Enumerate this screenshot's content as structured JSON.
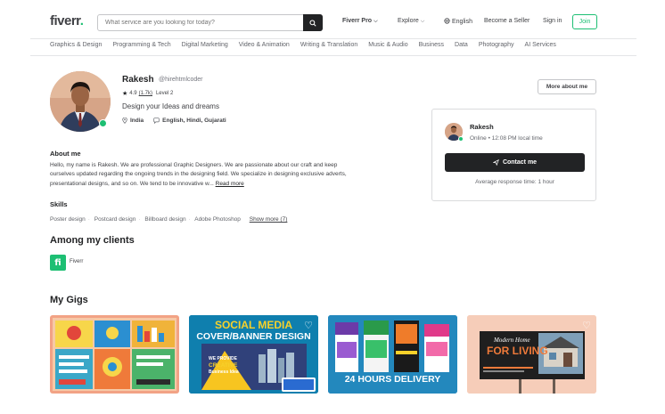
{
  "header": {
    "logo": "fiverr",
    "logo_dot": ".",
    "search_placeholder": "What service are you looking for today?",
    "nav_pro": "Fiverr Pro",
    "nav_explore": "Explore",
    "nav_language": "English",
    "nav_seller": "Become a Seller",
    "nav_signin": "Sign in",
    "join": "Join"
  },
  "categories": [
    "Graphics & Design",
    "Programming & Tech",
    "Digital Marketing",
    "Video & Animation",
    "Writing & Translation",
    "Music & Audio",
    "Business",
    "Data",
    "Photography",
    "AI Services"
  ],
  "profile": {
    "name": "Rakesh",
    "handle": "@hirehtmlcoder",
    "rating": "4.9",
    "review_count": "(1.7k)",
    "level": "Level 2",
    "tagline": "Design your Ideas and dreams",
    "location": "India",
    "languages": "English, Hindi, Gujarati",
    "more_about": "More about me"
  },
  "contact_card": {
    "name": "Rakesh",
    "status": "Online • 12:08 PM local time",
    "button": "Contact me",
    "response": "Average response time: 1 hour"
  },
  "about": {
    "heading": "About me",
    "text": "Hello, my name is Rakesh. We are professional Graphic Designers. We are passionate about our craft and keep ourselves updated regarding the ongoing trends in the designing field. We specialize in designing exclusive adverts, presentational designs, and so on. We tend to be innovative w...",
    "read_more": "Read more"
  },
  "skills": {
    "heading": "Skills",
    "items": [
      "Poster design",
      "Postcard design",
      "Billboard design",
      "Adobe Photoshop"
    ],
    "show_more": "Show more (7)"
  },
  "clients": {
    "heading": "Among my clients",
    "logo_letter": "fi",
    "name": "Fiverr"
  },
  "gigs": {
    "heading": "My Gigs",
    "gig2_title_1": "SOCIAL MEDIA",
    "gig2_title_2": "COVER/BANNER DESIGN",
    "gig2_badge_1": "WE PROVIDE",
    "gig2_badge_2": "CREATIVE",
    "gig2_badge_3": "Business Idea",
    "gig3_banner": "24 HOURS DELIVERY",
    "gig4_title_1": "Modern Home",
    "gig4_title_2": "FOR LIVING"
  },
  "icons": {
    "search": "search-icon",
    "globe": "globe-icon",
    "location": "location-pin-icon",
    "chat": "chat-bubble-icon",
    "send": "send-icon",
    "heart": "heart-icon"
  },
  "colors": {
    "brand_green": "#1dbf73",
    "dark": "#222325"
  }
}
